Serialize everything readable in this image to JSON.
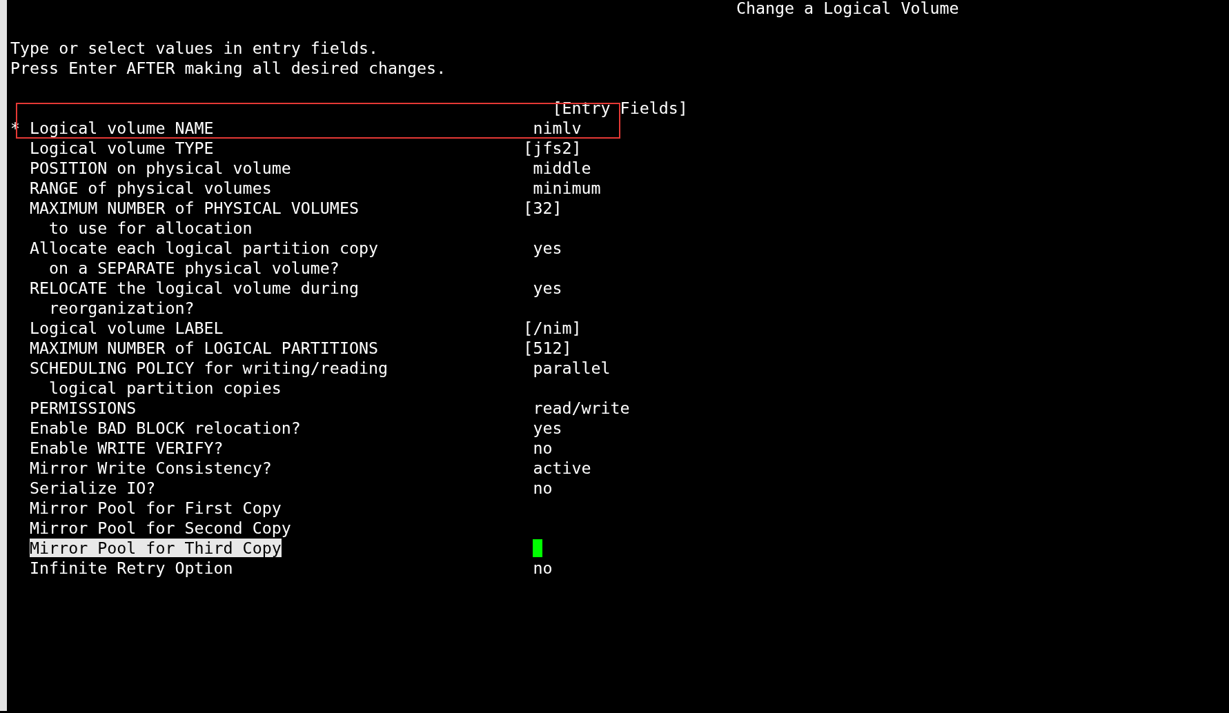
{
  "window": {
    "title": "Change a Logical Volume"
  },
  "instructions": [
    "Type or select values in entry fields.",
    "Press Enter AFTER making all desired changes."
  ],
  "column_header": "[Entry Fields]",
  "fields": [
    {
      "marker": "*",
      "label": [
        "Logical volume NAME"
      ],
      "value": "nimlv",
      "kind": "list",
      "selected": false,
      "cursor": false
    },
    {
      "label": [
        "Logical volume TYPE"
      ],
      "value": "[jfs2]",
      "kind": "entry",
      "selected": false,
      "cursor": false
    },
    {
      "label": [
        "POSITION on physical volume"
      ],
      "value": "middle",
      "kind": "list",
      "selected": false,
      "cursor": false
    },
    {
      "label": [
        "RANGE of physical volumes"
      ],
      "value": "minimum",
      "kind": "list",
      "selected": false,
      "cursor": false
    },
    {
      "label": [
        "MAXIMUM NUMBER of PHYSICAL VOLUMES",
        "to use for allocation"
      ],
      "value": "[32]",
      "kind": "entry",
      "selected": false,
      "cursor": false
    },
    {
      "label": [
        "Allocate each logical partition copy",
        "on a SEPARATE physical volume?"
      ],
      "value": "yes",
      "kind": "list",
      "selected": false,
      "cursor": false
    },
    {
      "label": [
        "RELOCATE the logical volume during",
        "reorganization?"
      ],
      "value": "yes",
      "kind": "list",
      "selected": false,
      "cursor": false
    },
    {
      "label": [
        "Logical volume LABEL"
      ],
      "value": "[/nim]",
      "kind": "entry",
      "selected": false,
      "cursor": false
    },
    {
      "label": [
        "MAXIMUM NUMBER of LOGICAL PARTITIONS"
      ],
      "value": "[512]",
      "kind": "entry",
      "selected": false,
      "cursor": false
    },
    {
      "label": [
        "SCHEDULING POLICY for writing/reading",
        "logical partition copies"
      ],
      "value": "parallel",
      "kind": "list",
      "selected": false,
      "cursor": false
    },
    {
      "label": [
        "PERMISSIONS"
      ],
      "value": "read/write",
      "kind": "list",
      "selected": false,
      "cursor": false
    },
    {
      "label": [
        "Enable BAD BLOCK relocation?"
      ],
      "value": "yes",
      "kind": "list",
      "selected": false,
      "cursor": false
    },
    {
      "label": [
        "Enable WRITE VERIFY?"
      ],
      "value": "no",
      "kind": "list",
      "selected": false,
      "cursor": false
    },
    {
      "label": [
        "Mirror Write Consistency?"
      ],
      "value": "active",
      "kind": "list",
      "selected": false,
      "cursor": false
    },
    {
      "label": [
        "Serialize IO?"
      ],
      "value": "no",
      "kind": "list",
      "selected": false,
      "cursor": false
    },
    {
      "label": [
        "Mirror Pool for First Copy"
      ],
      "kind": "list",
      "selected": false,
      "cursor": false
    },
    {
      "label": [
        "Mirror Pool for Second Copy"
      ],
      "kind": "list",
      "selected": false,
      "cursor": false
    },
    {
      "label": [
        "Mirror Pool for Third Copy"
      ],
      "kind": "list",
      "selected": true,
      "cursor": true
    },
    {
      "label": [
        "Infinite Retry Option"
      ],
      "value": "no",
      "kind": "list",
      "selected": false,
      "cursor": false
    }
  ]
}
